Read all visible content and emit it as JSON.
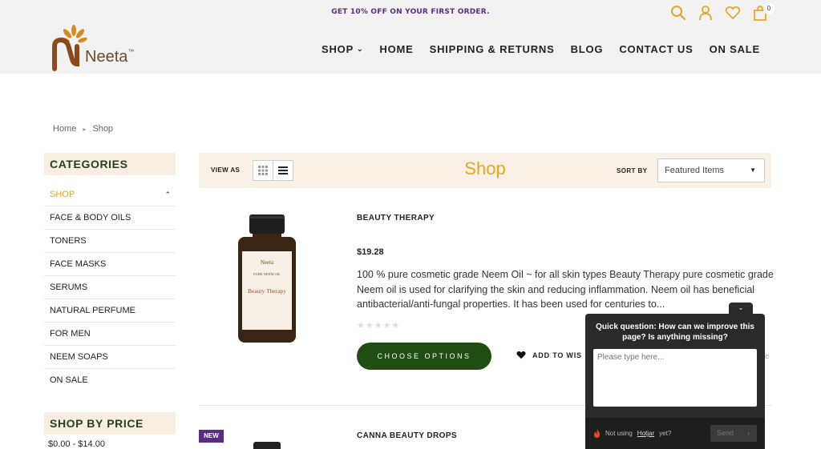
{
  "header": {
    "promo": "GET 10% OFF ON YOUR FIRST ORDER.",
    "logo_text": "Neeta",
    "logo_mark": "™",
    "cart_count": "0",
    "icons": [
      "search-icon",
      "user-icon",
      "heart-icon",
      "bag-icon"
    ]
  },
  "nav": {
    "items": [
      {
        "label": "SHOP"
      },
      {
        "label": "HOME"
      },
      {
        "label": "SHIPPING & RETURNS"
      },
      {
        "label": "BLOG"
      },
      {
        "label": "CONTACT US"
      },
      {
        "label": "ON SALE"
      }
    ]
  },
  "breadcrumb": {
    "home": "Home",
    "current": "Shop"
  },
  "sidebar": {
    "categories_title": "CATEGORIES",
    "categories": [
      {
        "label": "SHOP",
        "active": true
      },
      {
        "label": "FACE & BODY OILS"
      },
      {
        "label": "TONERS"
      },
      {
        "label": "FACE MASKS"
      },
      {
        "label": "SERUMS"
      },
      {
        "label": "NATURAL PERFUME"
      },
      {
        "label": "FOR MEN"
      },
      {
        "label": "NEEM SOAPS"
      },
      {
        "label": "ON SALE"
      }
    ],
    "price_title": "SHOP BY PRICE",
    "price_first": "$0.00 - $14.00"
  },
  "toolbar": {
    "view_as": "VIEW AS",
    "title": "Shop",
    "sort_by": "SORT BY",
    "sort_value": "Featured Items"
  },
  "products": [
    {
      "name": "BEAUTY THERAPY",
      "price": "$19.28",
      "description": "100 % pure cosmetic grade Neem Oil ~ for all skin types Beauty Therapy pure cosmetic grade Neem oil is used for clarifying the skin and reducing inflammation. Neem oil has beneficial antibacterial/anti-fungal properties. It has been used for centuries to...",
      "label_brand": "Neeta",
      "label_line": "PURE NEEM OIL",
      "label_name": "Beauty Therapy",
      "rating": 0,
      "cta": "CHOOSE OPTIONS",
      "wishlist": "ADD TO WIS"
    },
    {
      "badge": "NEW",
      "name": "CANNA BEAUTY DROPS"
    }
  ],
  "hotjar": {
    "question": "Quick question: How can we improve this page? Is anything missing?",
    "placeholder": "Please type here...",
    "footer_prefix": "Not using",
    "footer_link": "Hotjar",
    "footer_suffix": "yet?",
    "send": "Send",
    "overflow_letter": "e"
  },
  "colors": {
    "accent": "#e6a41f",
    "brand_green": "#1f4d12",
    "promo_purple": "#5a2d82",
    "sidebar_bg": "#f9eee2"
  }
}
